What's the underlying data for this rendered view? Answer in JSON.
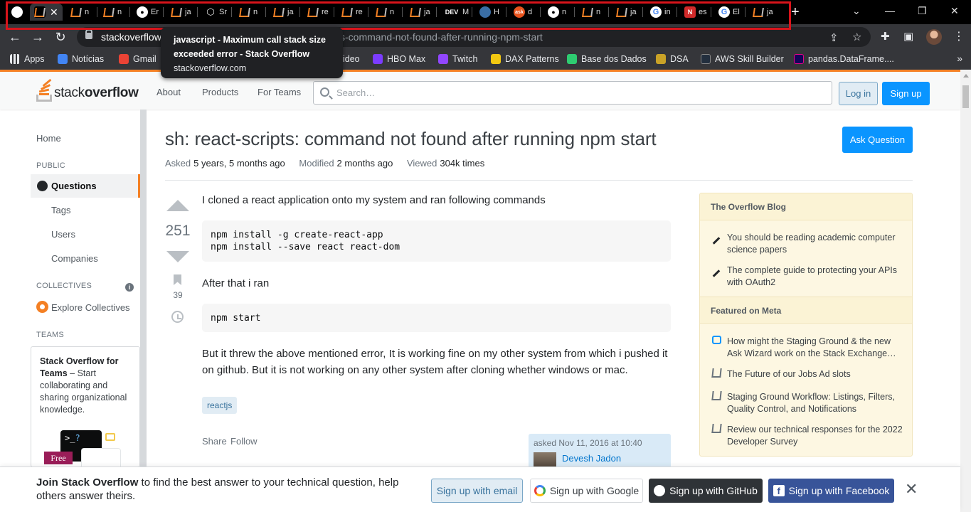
{
  "browser": {
    "active_tab_close": "✕",
    "tabs": [
      {
        "icon": "stackoverflow-icon",
        "text": "n"
      },
      {
        "icon": "stackoverflow-icon",
        "text": "n"
      },
      {
        "icon": "github-icon",
        "text": "Er"
      },
      {
        "icon": "stackoverflow-icon",
        "text": "ja"
      },
      {
        "icon": "cube-icon",
        "text": "Sr"
      },
      {
        "icon": "stackoverflow-icon",
        "text": "n"
      },
      {
        "icon": "stackoverflow-icon",
        "text": "ja"
      },
      {
        "icon": "stackoverflow-icon",
        "text": "re"
      },
      {
        "icon": "stackoverflow-icon",
        "text": "re"
      },
      {
        "icon": "stackoverflow-icon",
        "text": "n"
      },
      {
        "icon": "stackoverflow-icon",
        "text": "ja"
      },
      {
        "icon": "dev-icon",
        "text": "M"
      },
      {
        "icon": "globe-icon",
        "text": "H"
      },
      {
        "icon": "ask-icon",
        "text": "d"
      },
      {
        "icon": "github-icon",
        "text": "n"
      },
      {
        "icon": "stackoverflow-icon",
        "text": "n"
      },
      {
        "icon": "stackoverflow-icon",
        "text": "ja"
      },
      {
        "icon": "google-icon",
        "text": "in"
      },
      {
        "icon": "n-icon",
        "text": "es"
      },
      {
        "icon": "google-icon",
        "text": "El"
      },
      {
        "icon": "stackoverflow-icon",
        "text": "ja"
      }
    ],
    "dev_label": "DEV",
    "ask_label": "ask",
    "g_label": "G",
    "n_label": "N",
    "new_tab": "+",
    "url_host": "stackoverflow",
    "url_path": "s-command-not-found-after-running-npm-start",
    "bookmarks": [
      {
        "label": "Apps",
        "color": "#e8eaed"
      },
      {
        "label": "Notícias",
        "color": "#4285f4"
      },
      {
        "label": "Gmail",
        "color": "#ea4335"
      },
      {
        "label": "ideo",
        "color": "#35363a"
      },
      {
        "label": "HBO Max",
        "color": "#7b3cff"
      },
      {
        "label": "Twitch",
        "color": "#9146ff"
      },
      {
        "label": "DAX Patterns",
        "color": "#f2c811"
      },
      {
        "label": "Base dos Dados",
        "color": "#2ecc71"
      },
      {
        "label": "DSA",
        "color": "#c9a227"
      },
      {
        "label": "AWS Skill Builder",
        "color": "#232f3e"
      },
      {
        "label": "pandas.DataFrame....",
        "color": "#150458"
      }
    ],
    "bookmarks_more": "»",
    "tooltip": {
      "title": "javascript - Maximum call stack size exceeded error - Stack Overflow",
      "host": "stackoverflow.com"
    }
  },
  "so": {
    "logo_light": "stack",
    "logo_bold": "overflow",
    "nav": [
      "About",
      "Products",
      "For Teams"
    ],
    "search_placeholder": "Search…",
    "login": "Log in",
    "signup": "Sign up"
  },
  "sidebar": {
    "home": "Home",
    "public": "PUBLIC",
    "questions": "Questions",
    "tags": "Tags",
    "users": "Users",
    "companies": "Companies",
    "collectives_head": "COLLECTIVES",
    "info": "i",
    "explore_collectives": "Explore Collectives",
    "teams_head": "TEAMS",
    "teams_title": "Stack Overflow for Teams",
    "teams_text": " – Start collaborating and sharing organizational knowledge.",
    "teams_prompt": ">_",
    "teams_q": "?",
    "teams_free": "Free"
  },
  "question": {
    "title": "sh: react-scripts: command not found after running npm start",
    "asked_label": "Asked",
    "asked_value": "5 years, 5 months ago",
    "modified_label": "Modified",
    "modified_value": "2 months ago",
    "viewed_label": "Viewed",
    "viewed_value": "304k times",
    "ask_button": "Ask Question",
    "votes": "251",
    "bookmarks": "39",
    "p1": "I cloned a react application onto my system and ran following commands",
    "code1": "npm install -g create-react-app\nnpm install --save react react-dom",
    "p2": "After that i ran",
    "code2": "npm start",
    "p3": "But it threw the above mentioned error, It is working fine on my other system from which i pushed it on github. But it is not working on any other system after cloning whether windows or mac.",
    "tag": "reactjs",
    "share": "Share",
    "follow": "Follow",
    "asked_on": "asked Nov 11, 2016 at 10:40",
    "author": "Devesh Jadon"
  },
  "rightbar": {
    "blog_head": "The Overflow Blog",
    "blog_items": [
      "You should be reading academic computer science papers",
      "The complete guide to protecting your APIs with OAuth2"
    ],
    "meta_head": "Featured on Meta",
    "meta_items": [
      "How might the Staging Ground & the new Ask Wizard work on the Stack Exchange…",
      "The Future of our Jobs Ad slots",
      "Staging Ground Workflow: Listings, Filters, Quality Control, and Notifications",
      "Review our technical responses for the 2022 Developer Survey"
    ]
  },
  "banner": {
    "bold": "Join Stack Overflow",
    "text": " to find the best answer to your technical question, help others answer theirs.",
    "email": "Sign up with email",
    "google": "Sign up with Google",
    "github": "Sign up with GitHub",
    "facebook": "Sign up with Facebook",
    "close": "✕"
  },
  "colors": {
    "accent": "#f48024",
    "primary_button": "#0a95ff",
    "tab_outline": "#d8141b"
  }
}
